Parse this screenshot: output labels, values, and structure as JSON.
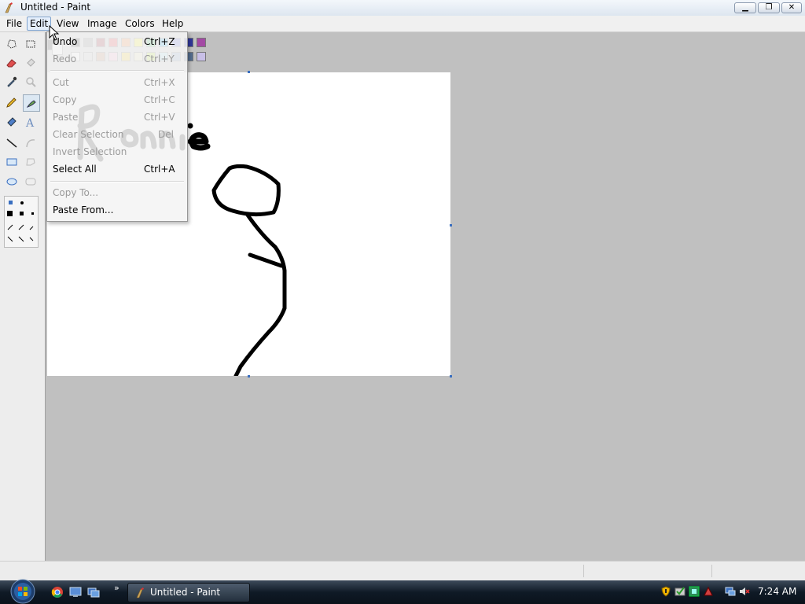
{
  "window": {
    "title": "Untitled - Paint"
  },
  "menubar": {
    "items": [
      {
        "label": "File"
      },
      {
        "label": "Edit"
      },
      {
        "label": "View"
      },
      {
        "label": "Image"
      },
      {
        "label": "Colors"
      },
      {
        "label": "Help"
      }
    ],
    "active": "Edit"
  },
  "edit_menu": {
    "undo": {
      "label": "Undo",
      "shortcut": "Ctrl+Z",
      "enabled": true
    },
    "redo": {
      "label": "Redo",
      "shortcut": "Ctrl+Y",
      "enabled": false
    },
    "cut": {
      "label": "Cut",
      "shortcut": "Ctrl+X",
      "enabled": false
    },
    "copy": {
      "label": "Copy",
      "shortcut": "Ctrl+C",
      "enabled": false
    },
    "paste": {
      "label": "Paste",
      "shortcut": "Ctrl+V",
      "enabled": false
    },
    "clear_selection": {
      "label": "Clear Selection",
      "shortcut": "Del",
      "enabled": false
    },
    "invert_selection": {
      "label": "Invert Selection",
      "shortcut": "",
      "enabled": false
    },
    "select_all": {
      "label": "Select All",
      "shortcut": "Ctrl+A",
      "enabled": true
    },
    "copy_to": {
      "label": "Copy To...",
      "shortcut": "",
      "enabled": false
    },
    "paste_from": {
      "label": "Paste From...",
      "shortcut": "",
      "enabled": true
    }
  },
  "palette": {
    "row1": [
      "#000000",
      "#7f7f7f",
      "#880015",
      "#ed1c24",
      "#ff7f27",
      "#fff200",
      "#22b14c",
      "#00a2e8",
      "#3f48cc",
      "#2f3699",
      "#a349a4"
    ],
    "row2": [
      "#ffffff",
      "#c3c3c3",
      "#b97a57",
      "#ffaec9",
      "#ffc90e",
      "#efe4b0",
      "#b5e61d",
      "#99d9ea",
      "#7092be",
      "#546d8e",
      "#c8bfe7"
    ]
  },
  "canvas": {
    "text": "Ronnie"
  },
  "taskbar": {
    "task_label": "Untitled - Paint",
    "clock": "7:24 AM",
    "quicklaunch_more": "»"
  }
}
